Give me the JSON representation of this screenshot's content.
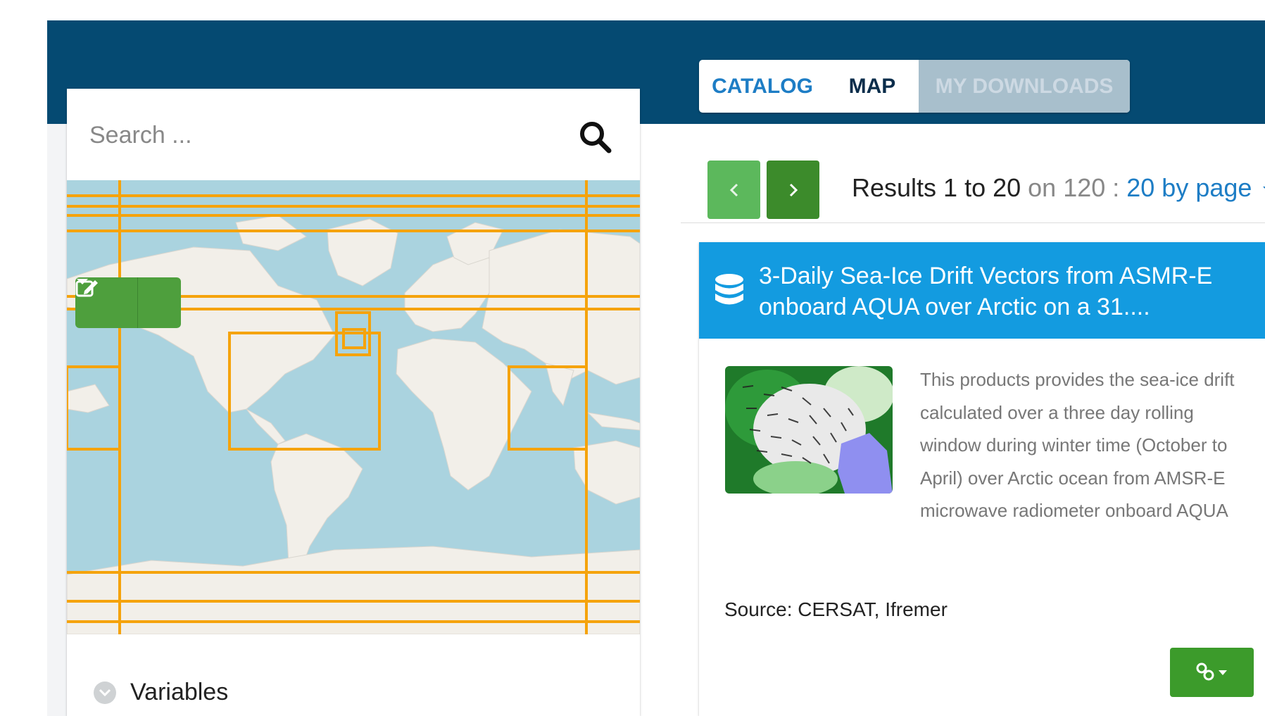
{
  "nav": {
    "tabs": [
      {
        "label": "CATALOG"
      },
      {
        "label": "MAP"
      },
      {
        "label": "MY DOWNLOADS"
      }
    ]
  },
  "search": {
    "placeholder": "Search ..."
  },
  "map": {
    "draw_tool_icon": "edit-icon",
    "dropdown_icon": "caret-down-icon",
    "info_label": "i",
    "box_color": "#f5a30c",
    "ocean_color": "#aad3df",
    "land_color": "#f2efe9"
  },
  "filters": {
    "variables_label": "Variables"
  },
  "pagination": {
    "prev_icon": "chevron-left-icon",
    "next_icon": "chevron-right-icon",
    "results_prefix": "Results ",
    "range": "1 to 20",
    "on_text": " on 120 : ",
    "per_page": "20 by page"
  },
  "result": {
    "title": "3-Daily Sea-Ice Drift Vectors from ASMR-E onboard AQUA over Arctic on a 31....",
    "description": "This products provides the sea-ice drift calculated over a three day rolling window during winter time (October to April) over Arctic ocean from AMSR-E microwave radiometer onboard AQUA",
    "source": "Source: CERSAT, Ifremer",
    "header_color": "#139be0",
    "link_icon": "link-icon"
  }
}
